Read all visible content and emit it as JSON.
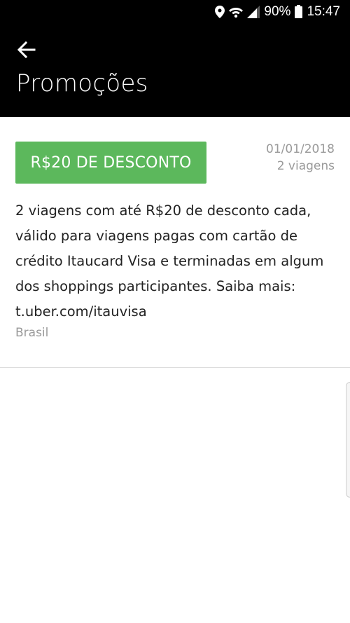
{
  "status_bar": {
    "battery": "90%",
    "time": "15:47",
    "icons": [
      "location-icon",
      "wifi-icon",
      "signal-icon",
      "battery-icon"
    ]
  },
  "app_bar": {
    "back_icon": "arrow-left-icon",
    "title": "Promoções"
  },
  "promotion": {
    "badge": "R$20 DE DESCONTO",
    "date": "01/01/2018",
    "trips": "2 viagens",
    "description": "2 viagens com até R$20 de desconto cada, válido para viagens pagas com cartão de crédito Itaucard Visa e terminadas em algum dos shoppings participantes. Saiba mais: t.uber.com/itauvisa",
    "region": "Brasil"
  },
  "colors": {
    "header_bg": "#000000",
    "badge_bg": "#5cb85c",
    "meta_text": "#9a9a9a"
  }
}
